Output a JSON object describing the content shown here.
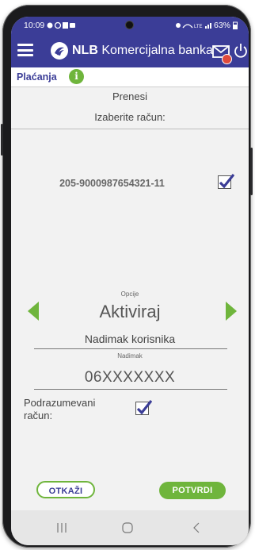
{
  "status_bar": {
    "time": "10:09",
    "battery": "63%"
  },
  "app_bar": {
    "brand_bold": "NLB",
    "brand_rest": " Komercijalna banka"
  },
  "subheader": {
    "title": "Plaćanja",
    "info_glyph": "i"
  },
  "form": {
    "heading": "Prenesi",
    "choose_account_label": "Izaberite račun:",
    "account_number": "205-9000987654321-11",
    "account_checked": true,
    "options_label": "Opcije",
    "option_value": "Aktiviraj",
    "nickname_value": "Nadimak korisnika",
    "nickname_label": "Nadimak",
    "code_value": "06XXXXXXX",
    "default_account_label_line1": "Podrazumevani",
    "default_account_label_line2": "račun:",
    "default_account_checked": true
  },
  "buttons": {
    "cancel": "OTKAŽI",
    "confirm": "POTVRDI"
  },
  "colors": {
    "primary": "#3b3d97",
    "accent": "#6fb53c",
    "badge": "#e04a3b"
  },
  "icons": {
    "menu": "hamburger-icon",
    "logo": "nlb-logo-icon",
    "mail": "mail-icon",
    "power": "power-icon",
    "info": "info-icon",
    "prev": "arrow-left-icon",
    "next": "arrow-right-icon",
    "nav_recent": "recent-apps-icon",
    "nav_home": "home-icon",
    "nav_back": "back-icon"
  }
}
